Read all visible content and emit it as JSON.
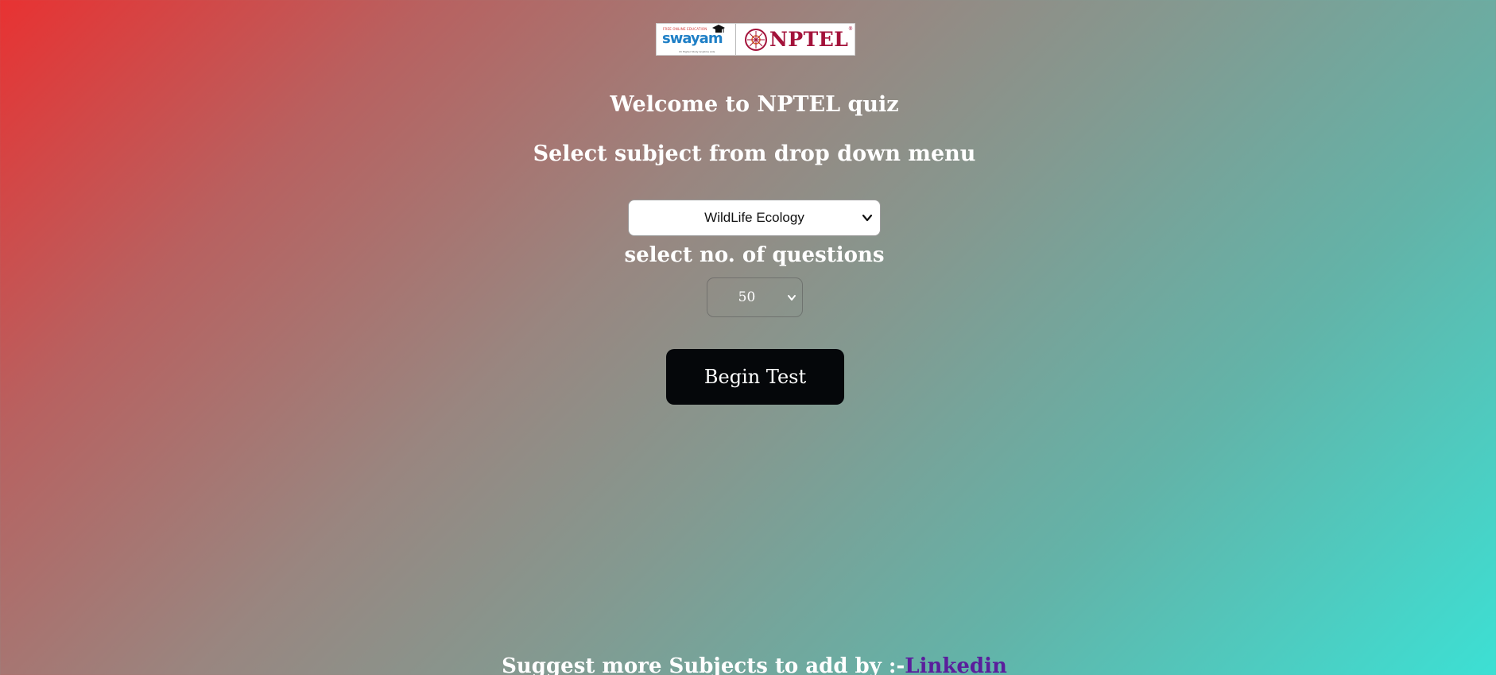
{
  "logo": {
    "swayam_top_text": "FREE ONLINE EDUCATION",
    "swayam_word": "swayam",
    "swayam_tagline": "Ch Higher Study Anytime Aids",
    "nptel_word": "NPTEL",
    "nptel_reg": "®"
  },
  "welcome_title": "Welcome to NPTEL quiz",
  "subject_heading": "Select subject from drop down menu",
  "subject_select": {
    "value": "WildLife Ecology"
  },
  "questions_heading": "select no. of questions",
  "count_select": {
    "value": "50"
  },
  "begin_button": "Begin Test",
  "footer": {
    "text": "Suggest more Subjects to add by :-",
    "link": "Linkedin"
  },
  "colors": {
    "gradient_start": "#e83232",
    "gradient_end": "#3ce0d4",
    "button_bg": "#05070a",
    "link": "#5a1e9c"
  }
}
